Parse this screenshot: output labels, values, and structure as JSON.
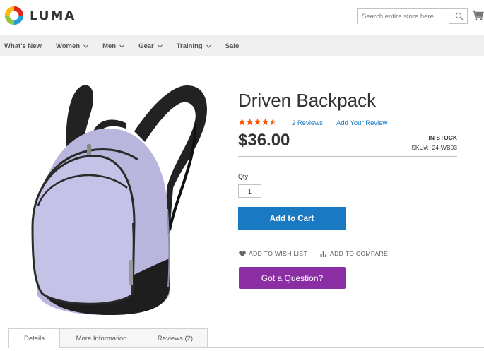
{
  "header": {
    "logo_text": "LUMA",
    "search_placeholder": "Search entire store here..."
  },
  "nav": {
    "items": [
      {
        "label": "What's New",
        "has_dropdown": false
      },
      {
        "label": "Women",
        "has_dropdown": true
      },
      {
        "label": "Men",
        "has_dropdown": true
      },
      {
        "label": "Gear",
        "has_dropdown": true
      },
      {
        "label": "Training",
        "has_dropdown": true
      },
      {
        "label": "Sale",
        "has_dropdown": false
      }
    ]
  },
  "product": {
    "name": "Driven Backpack",
    "rating_percent": 90,
    "reviews_link": "2  Reviews",
    "add_review_link": "Add Your Review",
    "price": "$36.00",
    "stock_status": "IN STOCK",
    "sku_label": "SKU#:",
    "sku_value": "24-WB03",
    "qty_label": "Qty",
    "qty_value": "1",
    "add_to_cart_label": "Add to Cart",
    "wishlist_label": "ADD TO WISH LIST",
    "compare_label": "ADD TO COMPARE",
    "question_label": "Got a Question?"
  },
  "tabs": [
    {
      "label": "Details",
      "active": true
    },
    {
      "label": "More Information",
      "active": false
    },
    {
      "label": "Reviews (2)",
      "active": false
    }
  ],
  "colors": {
    "accent_blue": "#1979c3",
    "question_purple": "#8c2ea3",
    "star_orange": "#ff5501",
    "nav_bg": "#f0f0f0"
  },
  "icons": [
    "luma-logo-icon",
    "search-icon",
    "cart-icon",
    "chevron-down-icon",
    "star-icon",
    "heart-icon",
    "bar-chart-icon"
  ]
}
